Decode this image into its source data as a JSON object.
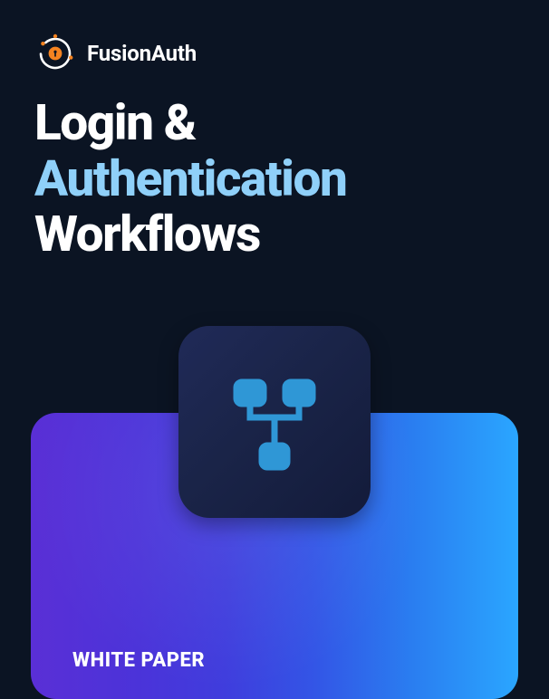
{
  "brand": {
    "name": "FusionAuth",
    "logo_icon": "fusionauth-target-icon"
  },
  "title": {
    "line1_white": "Login &",
    "line2_accent": "Authentication",
    "line3_white": "Workflows"
  },
  "card": {
    "label": "WHITE PAPER"
  },
  "tile": {
    "icon": "workflow-tree-icon"
  },
  "colors": {
    "background": "#0b1423",
    "accent_text": "#8fd0f9",
    "logo_orange": "#f58320",
    "tile_icon": "#2f97d6",
    "card_gradient_from": "#5a2fd6",
    "card_gradient_to": "#2aa6ff"
  }
}
